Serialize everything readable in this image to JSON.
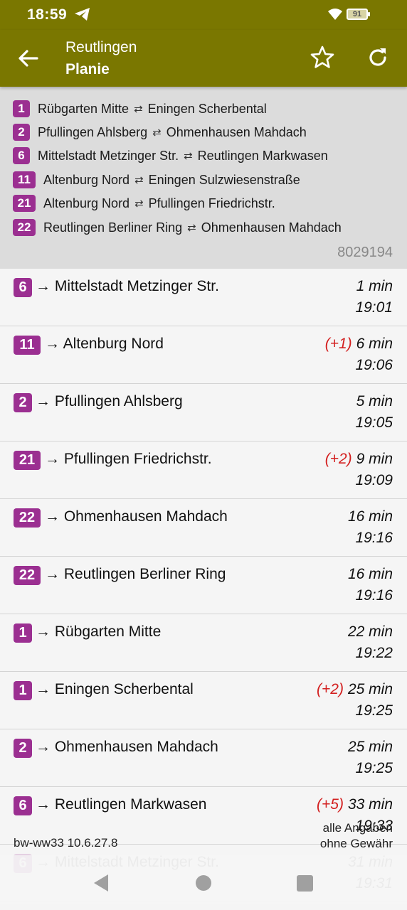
{
  "status_bar": {
    "time": "18:59",
    "battery": "91"
  },
  "header": {
    "city": "Reutlingen",
    "stop": "Planie"
  },
  "lines": [
    {
      "num": "1",
      "from": "Rübgarten Mitte",
      "to": "Eningen Scherbental"
    },
    {
      "num": "2",
      "from": "Pfullingen Ahlsberg",
      "to": "Ohmenhausen Mahdach"
    },
    {
      "num": "6",
      "from": "Mittelstadt Metzinger Str.",
      "to": "Reutlingen Markwasen"
    },
    {
      "num": "11",
      "from": "Altenburg Nord",
      "to": "Eningen Sulzwiesenstraße"
    },
    {
      "num": "21",
      "from": "Altenburg Nord",
      "to": "Pfullingen Friedrichstr."
    },
    {
      "num": "22",
      "from": "Reutlingen Berliner Ring",
      "to": "Ohmenhausen Mahdach"
    }
  ],
  "line_arrow": "⇄",
  "stop_id": "8029194",
  "departures": [
    {
      "line": "6",
      "dest": "→ Mittelstadt Metzinger Str.",
      "delay": "",
      "rel": "1 min",
      "abs": "19:01"
    },
    {
      "line": "11",
      "dest": "→ Altenburg Nord",
      "delay": "(+1)",
      "rel": "6 min",
      "abs": "19:06"
    },
    {
      "line": "2",
      "dest": "→ Pfullingen Ahlsberg",
      "delay": "",
      "rel": "5 min",
      "abs": "19:05"
    },
    {
      "line": "21",
      "dest": "→ Pfullingen Friedrichstr.",
      "delay": "(+2)",
      "rel": "9 min",
      "abs": "19:09"
    },
    {
      "line": "22",
      "dest": "→ Ohmenhausen Mahdach",
      "delay": "",
      "rel": "16 min",
      "abs": "19:16"
    },
    {
      "line": "22",
      "dest": "→ Reutlingen Berliner Ring",
      "delay": "",
      "rel": "16 min",
      "abs": "19:16"
    },
    {
      "line": "1",
      "dest": "→ Rübgarten Mitte",
      "delay": "",
      "rel": "22 min",
      "abs": "19:22"
    },
    {
      "line": "1",
      "dest": "→ Eningen Scherbental",
      "delay": "(+2)",
      "rel": "25 min",
      "abs": "19:25"
    },
    {
      "line": "2",
      "dest": "→ Ohmenhausen Mahdach",
      "delay": "",
      "rel": "25 min",
      "abs": "19:25"
    },
    {
      "line": "6",
      "dest": "→ Reutlingen Markwasen",
      "delay": "(+5)",
      "rel": "33 min",
      "abs": "19:33"
    },
    {
      "line": "6",
      "dest": "→ Mittelstadt Metzinger Str.",
      "delay": "",
      "rel": "31 min",
      "abs": "19:31"
    }
  ],
  "footer": {
    "version": "bw-ww33 10.6.27.8",
    "disclaimer_1": "alle Angaben",
    "disclaimer_2": "ohne Gewähr"
  },
  "colors": {
    "appbar": "#7a7700",
    "line_badge": "#9b2f91",
    "delay": "#d32020"
  },
  "icons": {
    "back": "arrow-left-icon",
    "favorite": "star-outline-icon",
    "refresh": "refresh-icon",
    "messenger": "telegram-icon",
    "wifi": "wifi-icon",
    "battery": "battery-icon"
  }
}
